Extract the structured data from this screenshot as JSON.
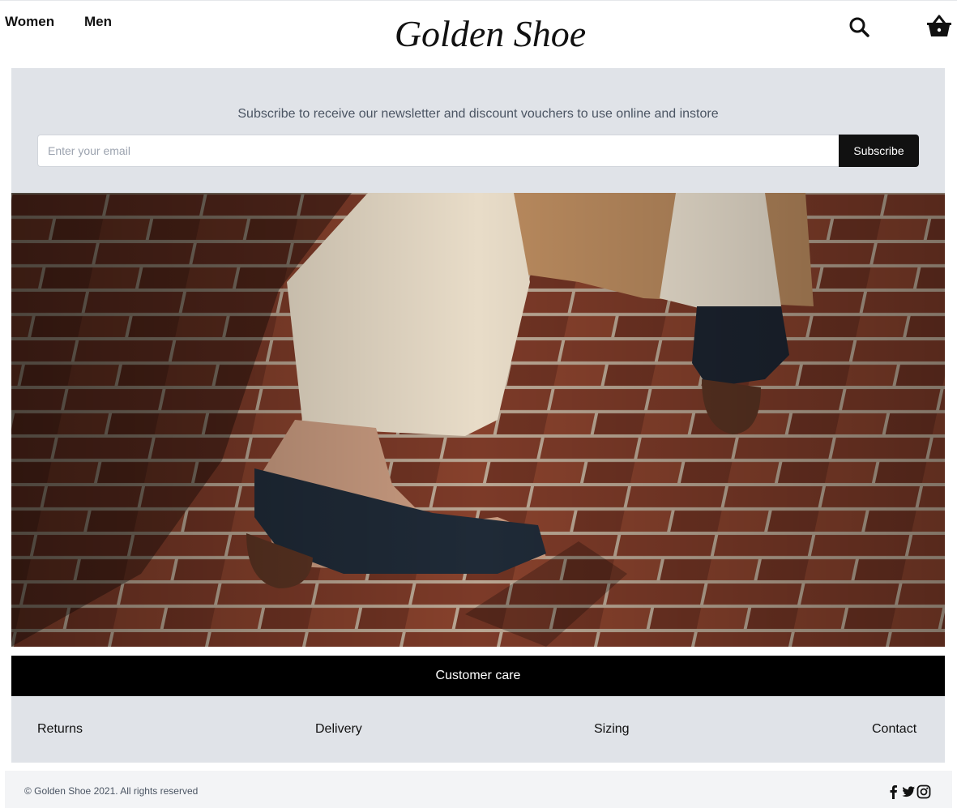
{
  "header": {
    "nav": [
      {
        "label": "Women"
      },
      {
        "label": "Men"
      }
    ],
    "logo_text": "Golden Shoe",
    "icons": {
      "search": "search-icon",
      "cart": "basket-icon"
    }
  },
  "newsletter": {
    "text": "Subscribe to receive our newsletter and discount vouchers to use online and instore",
    "email_placeholder": "Enter your email",
    "email_value": "",
    "subscribe_label": "Subscribe"
  },
  "hero": {
    "content": "photo of navy heeled shoes on a brick pavement"
  },
  "customer_care": {
    "title": "Customer care",
    "links": [
      {
        "label": "Returns"
      },
      {
        "label": "Delivery"
      },
      {
        "label": "Sizing"
      },
      {
        "label": "Contact"
      }
    ]
  },
  "footer": {
    "copyright": "© Golden Shoe 2021. All rights reserved",
    "social": [
      "facebook-icon",
      "twitter-icon",
      "instagram-icon"
    ]
  },
  "colors": {
    "panel": "#e0e3e8",
    "dark": "#111111",
    "muted_text": "#4b5563",
    "brick": "#7a3b2a"
  }
}
